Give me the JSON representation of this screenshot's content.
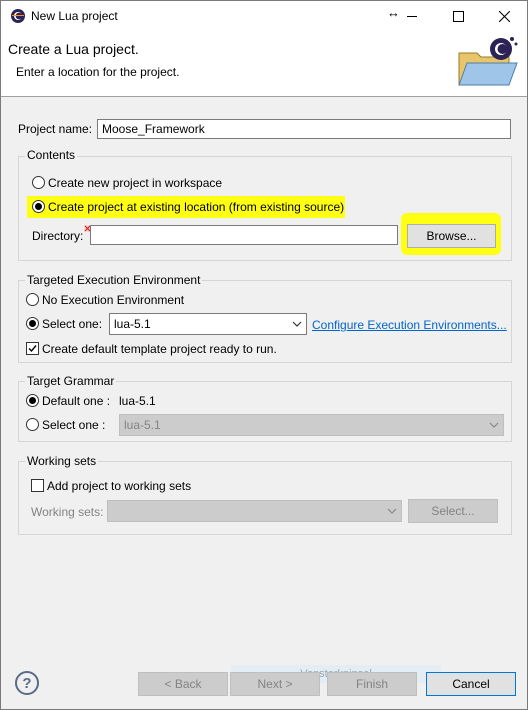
{
  "window": {
    "title": "New Lua project",
    "resize_glyph": "↔",
    "colors": {
      "highlight": "#ffff14",
      "link": "#0066cc",
      "accent": "#0078d7"
    }
  },
  "header": {
    "title": "Create a Lua project.",
    "subtitle": "Enter a location for the project."
  },
  "project": {
    "name_label": "Project name:",
    "name_value": "Moose_Framework"
  },
  "contents": {
    "title": "Contents",
    "option_workspace": "Create new project in workspace",
    "option_existing": "Create project at existing location (from existing source)",
    "selected": "existing",
    "directory_label": "Directory:",
    "directory_value": "",
    "browse_label": "Browse..."
  },
  "execution_env": {
    "title": "Targeted Execution Environment",
    "option_none": "No Execution Environment",
    "option_select": "Select one:",
    "select_value": "lua-5.1",
    "configure_link": "Configure Execution Environments...",
    "template_checkbox": "Create default template project ready to run.",
    "template_checked": true
  },
  "grammar": {
    "title": "Target Grammar",
    "option_default": "Default one :",
    "default_value": "lua-5.1",
    "option_select": "Select one :",
    "select_value": "lua-5.1"
  },
  "working_sets": {
    "title": "Working sets",
    "add_checkbox": "Add project to working sets",
    "add_checked": false,
    "sets_label": "Working sets:",
    "sets_value": "",
    "select_button": "Select..."
  },
  "footer": {
    "help_glyph": "?",
    "snip_tooltip": "Vensterknipsel",
    "back": "< Back",
    "next": "Next >",
    "finish": "Finish",
    "cancel": "Cancel"
  }
}
